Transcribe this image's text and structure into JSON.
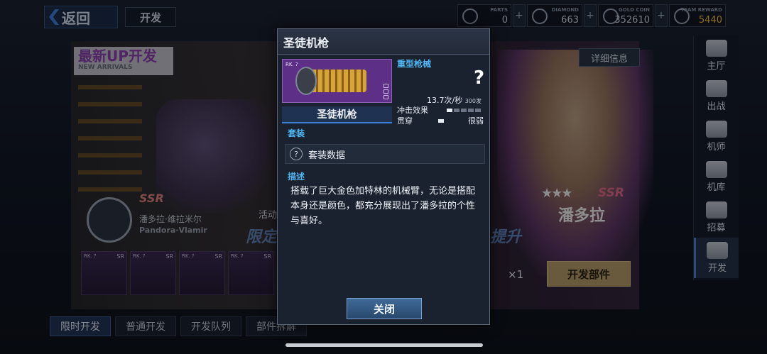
{
  "topbar": {
    "back_label": "返回",
    "page_title": "开发",
    "resources": [
      {
        "label": "PARTS",
        "value": "0",
        "icon": "parts-key-icon"
      },
      {
        "label": "DIAMOND",
        "value": "663",
        "icon": "diamond-icon"
      },
      {
        "label": "GOLD COIN",
        "value": "352610",
        "icon": "gold-coin-icon"
      },
      {
        "label": "TEAM REWARD",
        "value": "5440",
        "icon": "team-reward-icon"
      }
    ],
    "plus": "+"
  },
  "right_nav": {
    "items": [
      {
        "label": "主厅",
        "icon": "hall-icon"
      },
      {
        "label": "出战",
        "icon": "battle-icon"
      },
      {
        "label": "机师",
        "icon": "pilot-icon"
      },
      {
        "label": "机库",
        "icon": "hangar-icon"
      },
      {
        "label": "招募",
        "icon": "recruit-icon"
      },
      {
        "label": "开发",
        "icon": "develop-icon",
        "active": true
      }
    ]
  },
  "background": {
    "banner_title": "最新UP开发",
    "banner_sub": "NEW ARRIVALS",
    "detail_button": "详细信息",
    "ssr": "SSR",
    "pilot_name_cn": "潘多拉·维拉米尔",
    "pilot_name_en": "Pandora·Vlamir",
    "event_left": "活动",
    "event_text_left": "限定",
    "event_text_right": "提升",
    "right_ssr": "SSR",
    "right_stars": "★★★",
    "right_name": "潘多拉",
    "cards": [
      {
        "rank": "RK. ?",
        "rarity": "SR"
      },
      {
        "rank": "RK. ?",
        "rarity": "SR"
      },
      {
        "rank": "RK. ?",
        "rarity": "SR"
      },
      {
        "rank": "RK. ?",
        "rarity": "SR"
      }
    ],
    "multiplier": "×1",
    "dev_part_button": "开发部件",
    "bottom_tabs": [
      "限时开发",
      "普通开发",
      "开发队列",
      "部件拆解"
    ],
    "active_tab": 0
  },
  "modal": {
    "title": "圣徒机枪",
    "item_rank": "RK. ?",
    "item_name": "圣徒机枪",
    "type": "重型枪械",
    "level": "?",
    "rate": "13.7次/秒",
    "ammo": "300发",
    "impact_label": "冲击效果",
    "impact_level": 0.2,
    "pierce_label": "贯穿",
    "pierce_value": "很弱",
    "set_section": "套装",
    "set_data_label": "套装数据",
    "desc_section": "描述",
    "description": "搭载了巨大金色加特林的机械臂，无论是搭配本身还是颜色，都充分展现出了潘多拉的个性与喜好。",
    "close_button": "关闭"
  }
}
